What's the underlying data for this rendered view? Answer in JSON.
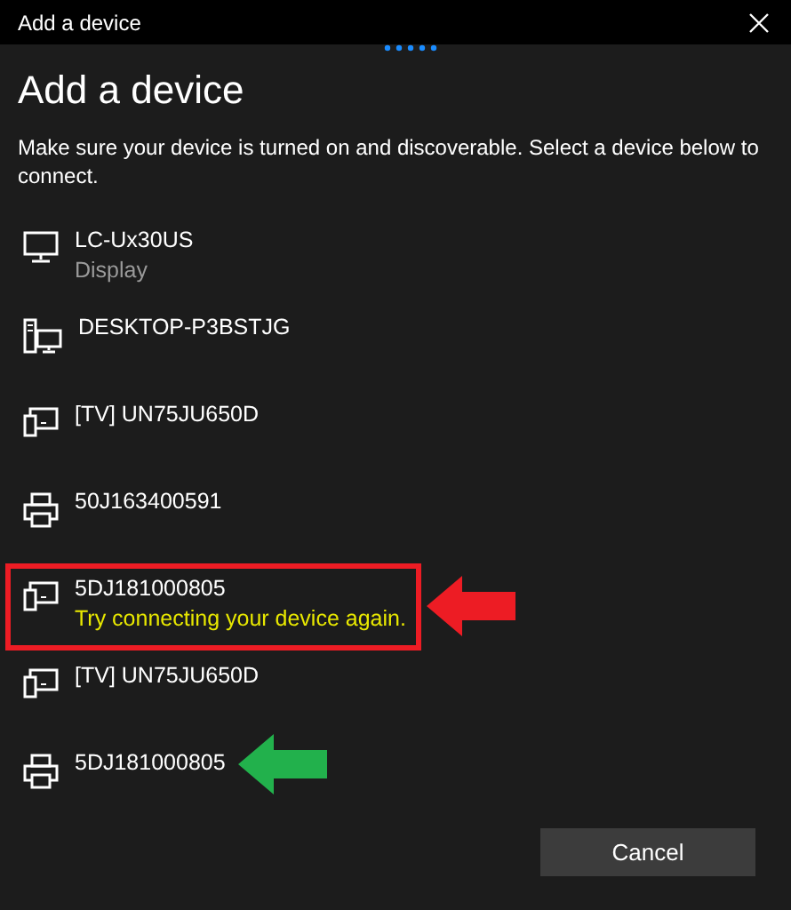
{
  "window": {
    "title": "Add a device"
  },
  "heading": "Add a device",
  "description": "Make sure your device is turned on and discoverable. Select a device below to connect.",
  "devices": [
    {
      "name": "LC-Ux30US",
      "detail": "Display",
      "error": false,
      "kind": "monitor",
      "highlighted": false
    },
    {
      "name": "DESKTOP-P3BSTJG",
      "kind": "desktop",
      "highlighted": false
    },
    {
      "name": "[TV] UN75JU650D",
      "kind": "tv",
      "highlighted": false
    },
    {
      "name": "50J163400591",
      "kind": "printer",
      "highlighted": false
    },
    {
      "name": "5DJ181000805",
      "detail": "Try connecting your device again.",
      "error": true,
      "kind": "tv",
      "highlighted": true,
      "color": "#ed1c24"
    },
    {
      "name": "[TV] UN75JU650D",
      "kind": "tv",
      "highlighted": false
    },
    {
      "name": "5DJ181000805",
      "kind": "printer",
      "highlighted": false,
      "color": "#22b14c"
    }
  ],
  "buttons": [
    "Cancel"
  ]
}
